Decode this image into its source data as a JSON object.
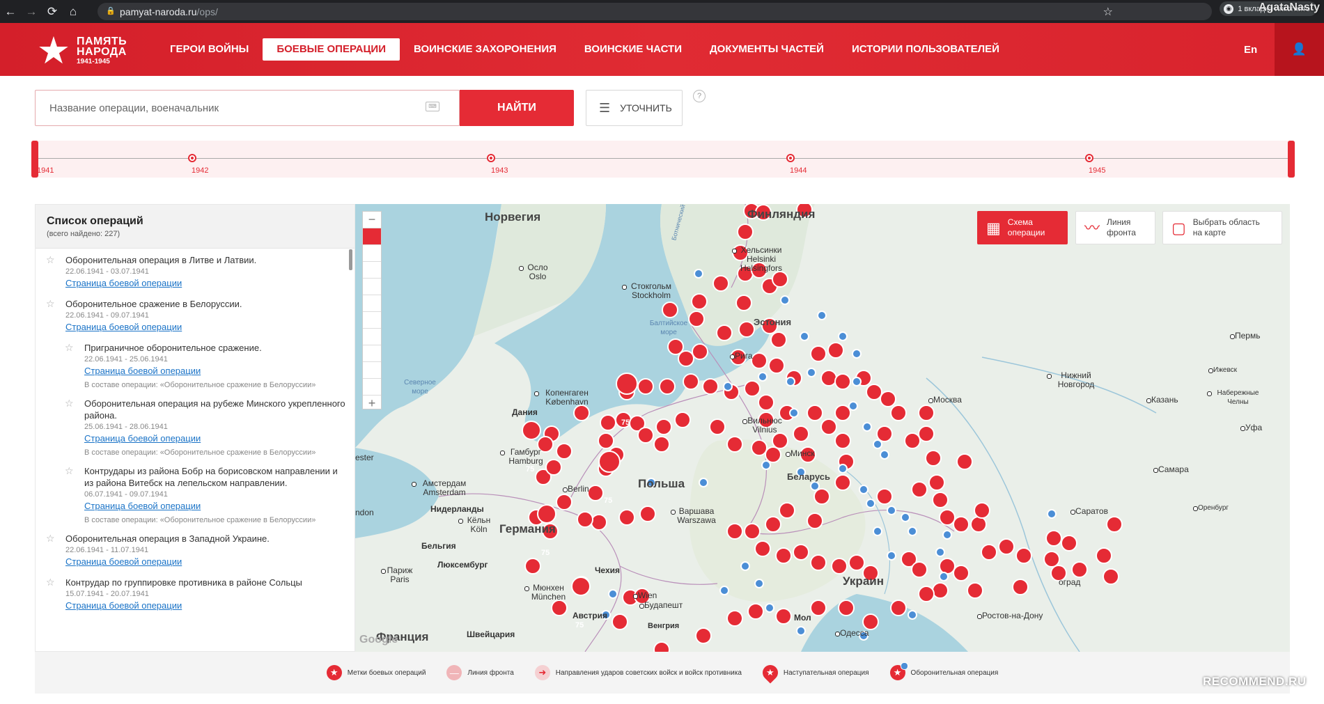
{
  "browser": {
    "url_host": "pamyat-naroda.ru",
    "url_path": "/ops/",
    "incognito_label": "1 вкладка инкогнито",
    "watermark": "AgataNasty"
  },
  "header": {
    "logo_line1": "ПАМЯТЬ",
    "logo_line2": "НАРОДА",
    "logo_years": "1941-1945",
    "menu": [
      {
        "label": "ГЕРОИ ВОЙНЫ"
      },
      {
        "label": "БОЕВЫЕ ОПЕРАЦИИ"
      },
      {
        "label": "ВОИНСКИЕ ЗАХОРОНЕНИЯ"
      },
      {
        "label": "ВОИНСКИЕ ЧАСТИ"
      },
      {
        "label": "ДОКУМЕНТЫ ЧАСТЕЙ"
      },
      {
        "label": "ИСТОРИИ ПОЛЬЗОВАТЕЛЕЙ"
      }
    ],
    "lang": "En"
  },
  "search": {
    "placeholder": "Название операции, военачальник",
    "find_label": "НАЙТИ",
    "refine_label": "УТОЧНИТЬ",
    "help": "?"
  },
  "timeline": {
    "labels": [
      "1941",
      "1942",
      "1943",
      "1944",
      "1945"
    ]
  },
  "ops": {
    "title": "Список операций",
    "count": "(всего найдено: 227)",
    "items": [
      {
        "name": "Оборонительная операция в Литве и Латвии.",
        "date": "22.06.1941 - 03.07.1941",
        "link": "Страница боевой операции",
        "parent": ""
      },
      {
        "name": "Оборонительное сражение в Белоруссии.",
        "date": "22.06.1941 - 09.07.1941",
        "link": "Страница боевой операции",
        "parent": ""
      },
      {
        "name": "Приграничное оборонительное сражение.",
        "date": "22.06.1941 - 25.06.1941",
        "link": "Страница боевой операции",
        "parent": "В составе операции: «Оборонительное сражение в Белоруссии»"
      },
      {
        "name": "Оборонительная операция на рубеже Минского укрепленного района.",
        "date": "25.06.1941 - 28.06.1941",
        "link": "Страница боевой операции",
        "parent": "В составе операции: «Оборонительное сражение в Белоруссии»"
      },
      {
        "name": "Контрудары из района Бобр на борисовском направлении и из района Витебск на лепельском направлении.",
        "date": "06.07.1941 - 09.07.1941",
        "link": "Страница боевой операции",
        "parent": "В составе операции: «Оборонительное сражение в Белоруссии»"
      },
      {
        "name": "Оборонительная операция в Западной Украине.",
        "date": "22.06.1941 - 11.07.1941",
        "link": "Страница боевой операции",
        "parent": ""
      },
      {
        "name": "Контрудар по группировке противника в районе Сольцы",
        "date": "15.07.1941 - 20.07.1941",
        "link": "Страница боевой операции",
        "parent": ""
      }
    ]
  },
  "map": {
    "buttons": {
      "scheme": "Схема операции",
      "front": "Линия фронта",
      "area": "Выбрать область на карте"
    },
    "countries": {
      "norway": "Норвегия",
      "finland": "Финляндия",
      "estonia": "Эстония",
      "poland": "Польша",
      "germany": "Германия",
      "belarus": "Беларусь",
      "ukraine": "Украин",
      "france": "Франция"
    },
    "seas": {
      "baltic": "Балтийское море",
      "north": "Северное море",
      "bothnia": "Ботнический"
    },
    "cities": {
      "oslo": "Осло Oslo",
      "stockholm": "Стокгольм Stockholm",
      "helsinki": "Хельсинки Helsinki Helsingfors",
      "copenhagen": "Копенгаген København",
      "danmark": "Дания",
      "hamburg": "Гамбург Hamburg",
      "amsterdam": "Амстердам Amsterdam",
      "netherlands": "Нидерланды",
      "koeln": "Кёльн Köln",
      "belgium": "Бельгия",
      "lux": "Люксембург",
      "paris": "Париж Paris",
      "munich": "Мюнхен München",
      "czech": "Чехия",
      "austria": "Австрия",
      "swiss": "Швейцария",
      "warsaw": "Варшава Warszawa",
      "minsk": "Минск",
      "vilnius": "Вильнюс Vilnius",
      "riga": "Рига",
      "moscow": "Москва",
      "nnovgorod": "Нижний Новгород",
      "kazan": "Казань",
      "perm": "Пермь",
      "izhevsk": "Ижевск",
      "chelny": "Набережные Челны",
      "ufa": "Уфа",
      "samara": "Самара",
      "saratov": "Саратов",
      "orenburg": "Оренбург",
      "rostov": "Ростов-на-Дону",
      "odessa": "Одесса",
      "budapest": "Будапешт",
      "vengria": "Венгрия",
      "moldova": "Мол",
      "wien": "Wien",
      "berlin": "Berlin",
      "volgograd": "оград",
      "london": "ndon",
      "ester": "ester"
    },
    "cluster_label": "75",
    "google": "Google"
  },
  "legend": {
    "items": [
      {
        "label": "Метки боевых операций"
      },
      {
        "label": "Линия фронта"
      },
      {
        "label": "Направления ударов советских войск и войск противника"
      },
      {
        "label": "Наступательная операция"
      },
      {
        "label": "Оборонительная операция"
      }
    ]
  },
  "watermark_bottom": "RECOMMEND.RU",
  "colors": {
    "brand_red": "#e52b35",
    "defensive_blue": "#4b8ed6"
  }
}
